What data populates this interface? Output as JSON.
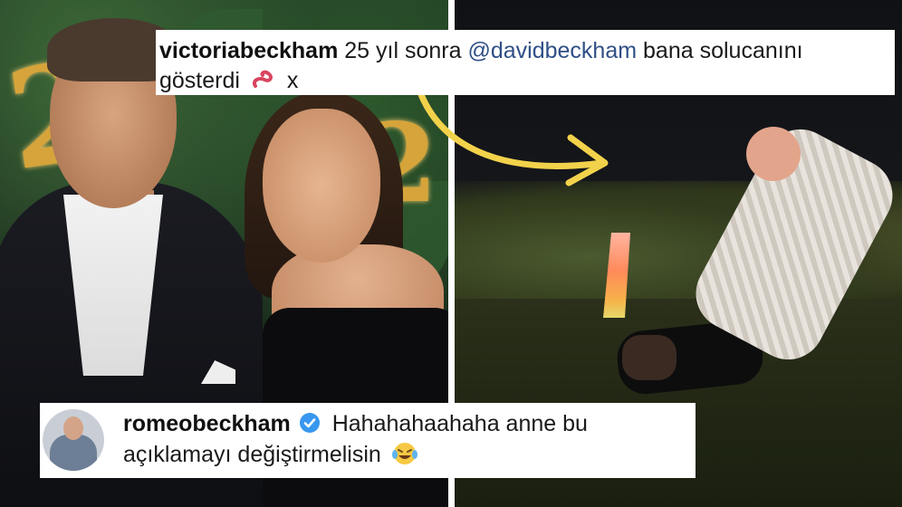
{
  "top_caption": {
    "username": "victoriabeckham",
    "text_before_mention": "25 yıl sonra",
    "mention": "@davidbeckham",
    "text_after_mention": "bana solucanını",
    "line2_text": "gösterdi",
    "emoji": "worm-emoji",
    "trailing": "x"
  },
  "bottom_caption": {
    "username": "romeobeckham",
    "verified": true,
    "line1_text": "Hahahahaahaha anne bu",
    "line2_text": "açıklamayı değiştirmelisin",
    "emoji": "laughing-tears-emoji"
  },
  "decor": {
    "gold_left": "2",
    "gold_right": "2"
  },
  "colors": {
    "arrow": "#f2d24b",
    "mention": "#2f4f86",
    "verified": "#3897f0"
  }
}
